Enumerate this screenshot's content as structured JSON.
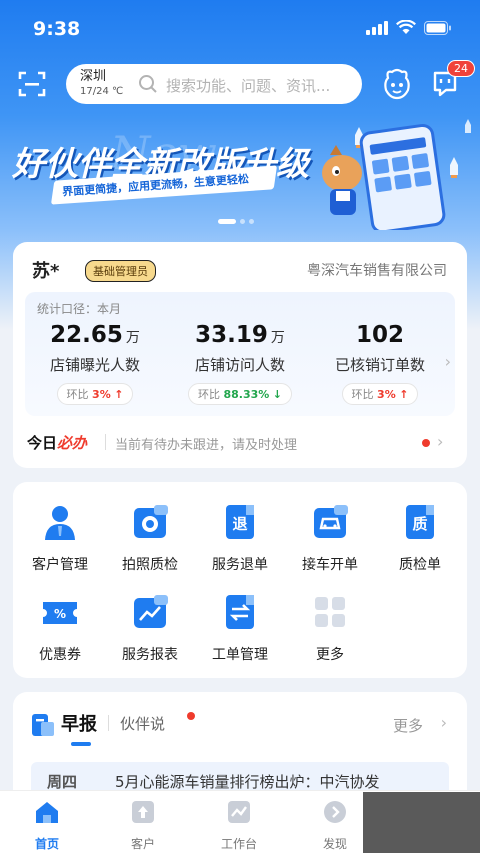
{
  "status": {
    "time": "9:38"
  },
  "header": {
    "city": "深圳",
    "temperature": "17/24 ℃",
    "search_placeholder": "搜索功能、问题、资讯...",
    "message_count": "24"
  },
  "banner": {
    "title": "好伙伴全新改版升级",
    "subtitle": "界面更简捷，应用更流畅，生意更轻松",
    "watermark": "New",
    "pages": 3,
    "active_page": 1
  },
  "store": {
    "name": "苏*",
    "role": "基础管理员",
    "company": "粤深汽车销售有限公司",
    "caption": "统计口径：本月",
    "stats": [
      {
        "value": "22.65",
        "unit": "万",
        "label": "店铺曝光人数",
        "change_label": "环比",
        "change": "3%",
        "direction": "up"
      },
      {
        "value": "33.19",
        "unit": "万",
        "label": "店铺访问人数",
        "change_label": "环比",
        "change": "88.33%",
        "direction": "down"
      },
      {
        "value": "102",
        "unit": "",
        "label": "已核销订单数",
        "change_label": "环比",
        "change": "3%",
        "direction": "up"
      }
    ]
  },
  "todo": {
    "title_prefix": "今日",
    "title_highlight": "必办",
    "text": "当前有待办未跟进，请及时处理"
  },
  "functions": [
    {
      "label": "客户管理",
      "icon": "customer-icon"
    },
    {
      "label": "拍照质检",
      "icon": "camera-icon"
    },
    {
      "label": "服务退单",
      "icon": "refund-icon"
    },
    {
      "label": "接车开单",
      "icon": "car-icon"
    },
    {
      "label": "质检单",
      "icon": "quality-icon"
    },
    {
      "label": "优惠券",
      "icon": "coupon-icon"
    },
    {
      "label": "服务报表",
      "icon": "report-icon"
    },
    {
      "label": "工单管理",
      "icon": "workorder-icon"
    },
    {
      "label": "更多",
      "icon": "more-icon"
    }
  ],
  "news": {
    "tab_active": "早报",
    "tab_other": "伙伴说",
    "more": "更多",
    "day": "周四",
    "headline": "5月心能源车销量排行榜出炉：中汽协发"
  },
  "tabbar": [
    {
      "label": "首页",
      "active": true
    },
    {
      "label": "客户",
      "active": false
    },
    {
      "label": "工作台",
      "active": false
    },
    {
      "label": "发现",
      "active": false
    }
  ],
  "colors": {
    "brand": "#1f7cf0",
    "alert": "#ef3b2d",
    "positive": "#22a64d",
    "badge_gold": "#f7d98d"
  }
}
